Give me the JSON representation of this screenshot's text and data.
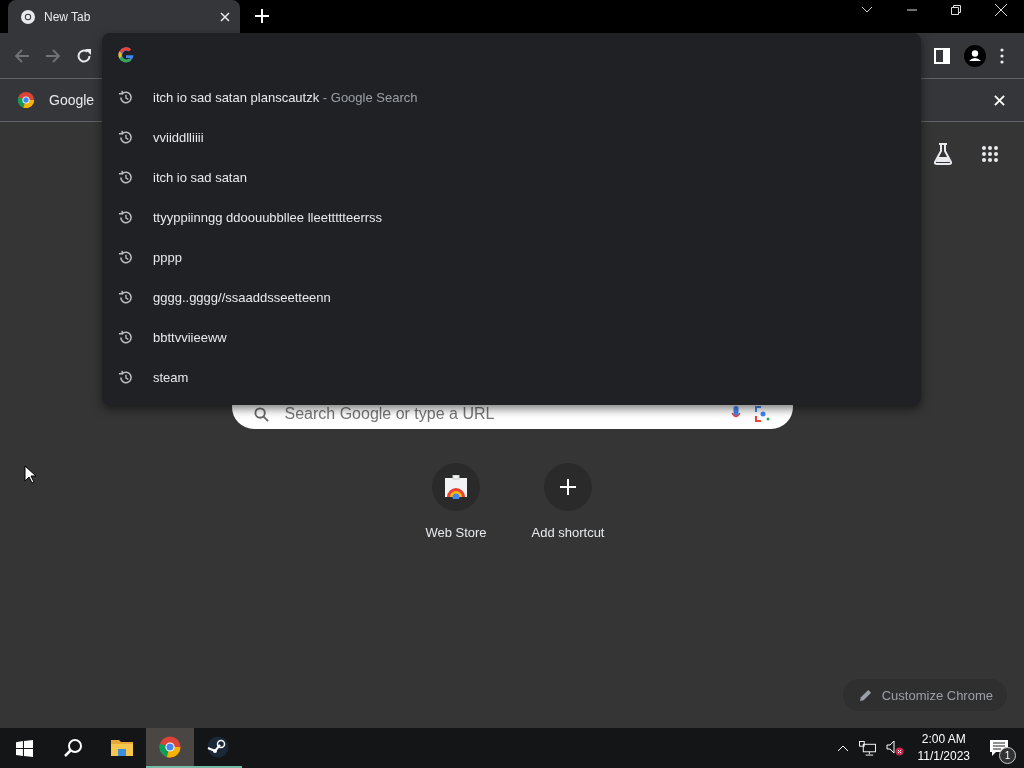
{
  "tab": {
    "title": "New Tab",
    "selected": true
  },
  "toolbar": {
    "back": {
      "disabled": true
    },
    "forward": {
      "disabled": true
    }
  },
  "info_bar": {
    "text": "Google"
  },
  "omnibox_dropdown": {
    "suggestions": [
      {
        "text": "itch io sad satan planscautzk",
        "suffix": "- Google Search"
      },
      {
        "text": "vviiddlliiii"
      },
      {
        "text": "itch io sad satan"
      },
      {
        "text": "ttyyppiinngg ddoouubbllee lleettttteerrss"
      },
      {
        "text": "pppp"
      },
      {
        "text": "gggg..gggg//ssaaddsseetteenn"
      },
      {
        "text": "bbttvviieeww"
      },
      {
        "text": "steam"
      }
    ]
  },
  "search_box": {
    "placeholder": "Search Google or type a URL"
  },
  "shortcuts": [
    {
      "kind": "site",
      "label": "Web Store"
    },
    {
      "kind": "add",
      "label": "Add shortcut"
    }
  ],
  "customize_button": {
    "label": "Customize Chrome"
  },
  "taskbar": {
    "apps": [
      {
        "kind": "explorer",
        "selected": false,
        "running": false
      },
      {
        "kind": "chrome",
        "selected": true,
        "running": true
      },
      {
        "kind": "steam",
        "selected": false,
        "running": true
      }
    ],
    "clock": {
      "time": "2:00 AM",
      "date": "11/1/2023"
    },
    "volume": {
      "muted": true
    },
    "notifications": {
      "count": "1"
    }
  }
}
